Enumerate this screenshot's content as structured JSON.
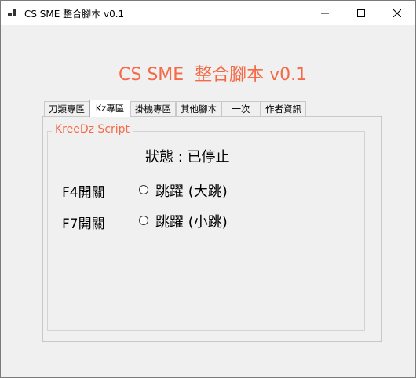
{
  "window": {
    "title": "CS SME 整合腳本 v0.1"
  },
  "app": {
    "heading": "CS SME  整合腳本 v0.1"
  },
  "tabs": [
    {
      "label": "刀類專區",
      "active": false
    },
    {
      "label": "Kz專區",
      "active": true
    },
    {
      "label": "掛機專區",
      "active": false
    },
    {
      "label": "其他腳本",
      "active": false
    },
    {
      "label": "一次",
      "active": false
    },
    {
      "label": "作者資訊",
      "active": false
    }
  ],
  "group": {
    "title": "KreeDz Script",
    "status": "狀態 : 已停止",
    "options": [
      {
        "key": "F4開關",
        "label": "跳躍 (大跳)",
        "checked": false
      },
      {
        "key": "F7開關",
        "label": "跳躍 (小跳)",
        "checked": false
      }
    ]
  },
  "colors": {
    "accent": "#f46a46",
    "background": "#f0f0f0"
  }
}
